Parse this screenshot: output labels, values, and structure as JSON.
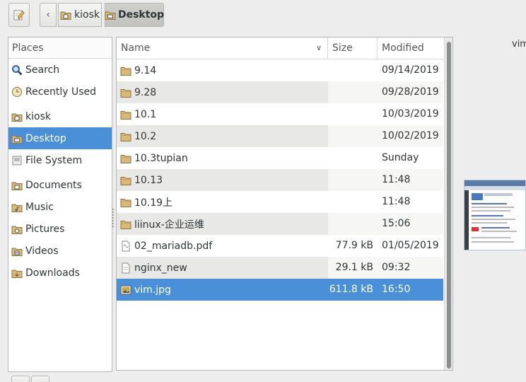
{
  "toolbar": {
    "breadcrumbs": [
      {
        "label": "kiosk",
        "icon": "home-folder-icon"
      },
      {
        "label": "Desktop",
        "icon": "desktop-folder-icon"
      }
    ]
  },
  "places": {
    "header": "Places",
    "items": [
      {
        "label": "Search",
        "icon": "search-icon"
      },
      {
        "label": "Recently Used",
        "icon": "recent-icon"
      },
      {
        "label": "kiosk",
        "icon": "home-folder-icon"
      },
      {
        "label": "Desktop",
        "icon": "desktop-folder-icon",
        "selected": true
      },
      {
        "label": "File System",
        "icon": "drive-icon"
      },
      {
        "label": "Documents",
        "icon": "documents-folder-icon"
      },
      {
        "label": "Music",
        "icon": "music-folder-icon"
      },
      {
        "label": "Pictures",
        "icon": "pictures-folder-icon"
      },
      {
        "label": "Videos",
        "icon": "videos-folder-icon"
      },
      {
        "label": "Downloads",
        "icon": "downloads-folder-icon"
      }
    ]
  },
  "files": {
    "columns": {
      "name": "Name",
      "size": "Size",
      "modified": "Modified"
    },
    "rows": [
      {
        "name": "9.14",
        "size": "",
        "modified": "09/14/2019",
        "icon": "folder-icon"
      },
      {
        "name": "9.28",
        "size": "",
        "modified": "09/28/2019",
        "icon": "folder-icon"
      },
      {
        "name": "10.1",
        "size": "",
        "modified": "10/03/2019",
        "icon": "folder-icon"
      },
      {
        "name": "10.2",
        "size": "",
        "modified": "10/02/2019",
        "icon": "folder-icon"
      },
      {
        "name": "10.3tupian",
        "size": "",
        "modified": "Sunday",
        "icon": "folder-icon"
      },
      {
        "name": "10.13",
        "size": "",
        "modified": "11:48",
        "icon": "folder-icon"
      },
      {
        "name": "10.19上",
        "size": "",
        "modified": "11:48",
        "icon": "folder-icon"
      },
      {
        "name": "liinux-企业运维",
        "size": "",
        "modified": "15:06",
        "icon": "folder-icon"
      },
      {
        "name": "02_mariadb.pdf",
        "size": "77.9 kB",
        "modified": "01/05/2019",
        "icon": "pdf-file-icon"
      },
      {
        "name": "nginx_new",
        "size": "29.1 kB",
        "modified": "09:32",
        "icon": "text-file-icon"
      },
      {
        "name": "vim.jpg",
        "size": "611.8 kB",
        "modified": "16:50",
        "icon": "image-file-icon",
        "selected": true
      }
    ]
  },
  "preview": {
    "filename": "vim.jpg"
  },
  "colors": {
    "selection": "#4a90d9",
    "folder": "#c8a566"
  }
}
